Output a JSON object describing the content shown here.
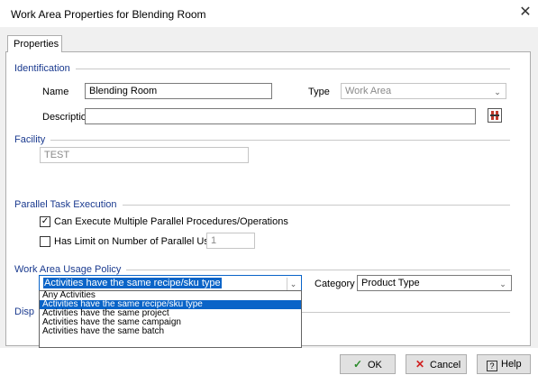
{
  "window": {
    "title": "Work Area Properties for Blending Room",
    "close_glyph": "✕"
  },
  "tabs": [
    {
      "label": "Properties"
    }
  ],
  "identification": {
    "header": "Identification",
    "name_label": "Name",
    "name_value": "Blending Room",
    "type_label": "Type",
    "type_value": "Work Area",
    "description_label": "Description",
    "description_value": ""
  },
  "facility": {
    "header": "Facility",
    "value": "TEST"
  },
  "parallel": {
    "header": "Parallel Task Execution",
    "can_execute_label": "Can Execute Multiple Parallel Procedures/Operations",
    "can_execute_checked": true,
    "has_limit_label": "Has Limit on Number of Parallel Uses",
    "has_limit_checked": false,
    "limit_value": "1"
  },
  "usage": {
    "header": "Work Area Usage Policy",
    "policy_value": "Activities have the same recipe/sku type",
    "category_label": "Category",
    "category_value": "Product Type",
    "options": [
      "Any Activities",
      "Activities have the same recipe/sku type",
      "Activities have the same project",
      "Activities have the same campaign",
      "Activities have the same batch"
    ],
    "selected_index": 1
  },
  "partial_header": "Disp",
  "buttons": {
    "ok": "OK",
    "cancel": "Cancel",
    "help": "Help",
    "ok_glyph": "✓",
    "cancel_glyph": "✕",
    "help_glyph": "?"
  }
}
